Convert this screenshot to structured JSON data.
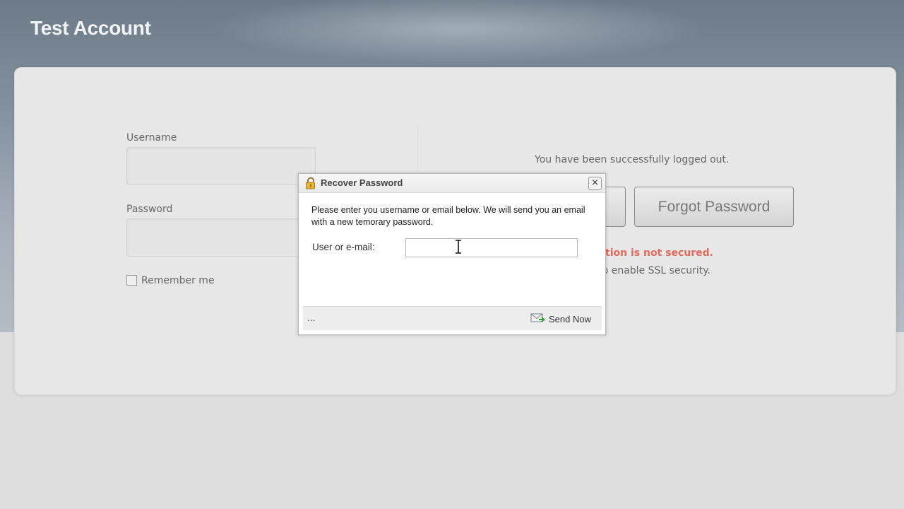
{
  "app": {
    "title": "Test Account"
  },
  "login": {
    "username_label": "Username",
    "password_label": "Password",
    "remember_label": "Remember me",
    "logout_message": "You have been successfully logged out.",
    "forgot_button": "Forgot Password",
    "warning_red": "ction is not secured.",
    "warning_grey": "o enable SSL security."
  },
  "dialog": {
    "title": "Recover Password",
    "close_glyph": "×",
    "message": "Please enter you username or email below. We will send you an email with a new temorary password.",
    "field_label": "User or e-mail:",
    "field_value": "",
    "footer_text": "...",
    "send_label": "Send Now"
  },
  "icons": {
    "lock": "lock-icon",
    "send": "send-mail-icon",
    "close": "close-icon",
    "cursor": "text-cursor-icon"
  },
  "colors": {
    "header_bg": "#6d7b88",
    "warning_red": "#e46a5c",
    "card_bg": "#e7e7e7"
  }
}
